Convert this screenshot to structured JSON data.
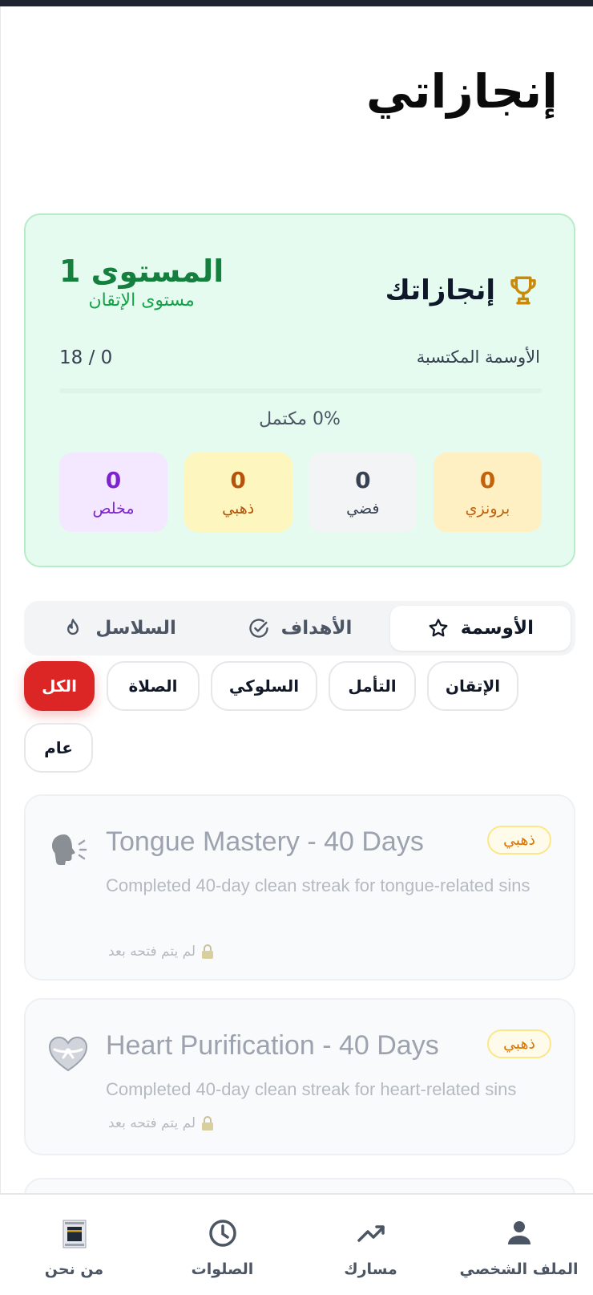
{
  "page": {
    "title": "إنجازاتي"
  },
  "summary": {
    "title": "إنجازاتك",
    "level": "المستوى 1",
    "level_subtitle": "مستوى الإتقان",
    "medals_label": "الأوسمة المكتسبة",
    "medals_count": "18 / 0",
    "progress": 0,
    "progress_text": "0% مكتمل",
    "tiers": [
      {
        "label": "برونزي",
        "count": "0"
      },
      {
        "label": "فضي",
        "count": "0"
      },
      {
        "label": "ذهبي",
        "count": "0"
      },
      {
        "label": "مخلص",
        "count": "0"
      }
    ]
  },
  "tabs": [
    {
      "label": "الأوسمة",
      "icon": "star-icon",
      "active": true
    },
    {
      "label": "الأهداف",
      "icon": "check-circle-icon",
      "active": false
    },
    {
      "label": "السلاسل",
      "icon": "flame-icon",
      "active": false
    }
  ],
  "filters": [
    {
      "label": "الكل",
      "active": true
    },
    {
      "label": "الصلاة",
      "active": false
    },
    {
      "label": "السلوكي",
      "active": false
    },
    {
      "label": "التأمل",
      "active": false
    },
    {
      "label": "الإتقان",
      "active": false
    },
    {
      "label": "عام",
      "active": false
    }
  ],
  "achievements": [
    {
      "title": "Tongue Mastery - 40 Days",
      "description": "Completed 40-day clean streak for tongue-related sins",
      "badge": "ذهبي",
      "locked_text": "لم يتم فتحه بعد",
      "icon": "speaking-head-icon"
    },
    {
      "title": "Heart Purification - 40 Days",
      "description": "Completed 40-day clean streak for heart-related sins",
      "badge": "ذهبي",
      "locked_text": "لم يتم فتحه بعد",
      "icon": "heart-ribbon-icon"
    }
  ],
  "bottom_nav": [
    {
      "label": "الملف الشخصي",
      "icon": "person-icon"
    },
    {
      "label": "مسارك",
      "icon": "trending-up-icon"
    },
    {
      "label": "الصلوات",
      "icon": "clock-icon"
    },
    {
      "label": "من نحن",
      "icon": "kaaba-icon"
    }
  ],
  "colors": {
    "accent_red": "#dc2626",
    "green": "#15803d",
    "summary_bg": "#e5fbef"
  }
}
